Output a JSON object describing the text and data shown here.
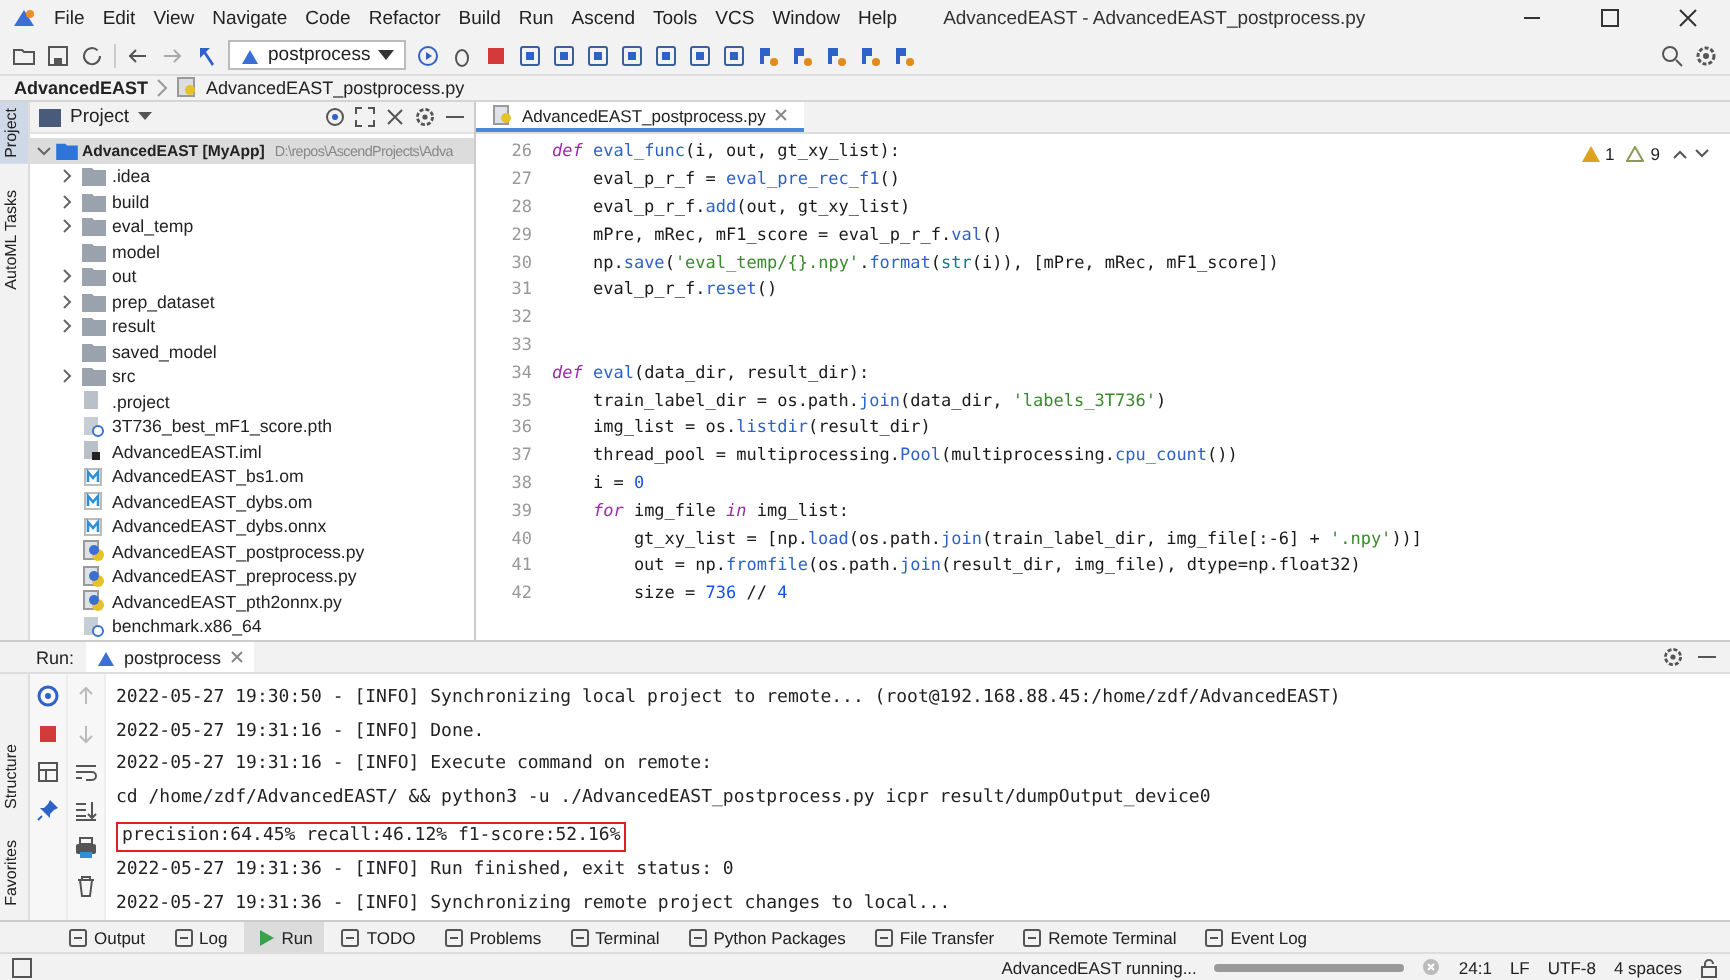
{
  "window": {
    "title": "AdvancedEAST - AdvancedEAST_postprocess.py"
  },
  "menu": [
    "File",
    "Edit",
    "View",
    "Navigate",
    "Code",
    "Refactor",
    "Build",
    "Run",
    "Ascend",
    "Tools",
    "VCS",
    "Window",
    "Help"
  ],
  "run_config": "postprocess",
  "breadcrumb": [
    "AdvancedEAST",
    "AdvancedEAST_postprocess.py"
  ],
  "left_stripe": [
    {
      "label": "Project",
      "selected": true
    },
    {
      "label": "AutoML Tasks",
      "selected": false
    }
  ],
  "project_panel": {
    "title": "Project",
    "root": {
      "name": "AdvancedEAST",
      "module": "[MyApp]",
      "path": "D:\\repos\\AscendProjects\\Adva",
      "expanded": true,
      "selected": true,
      "children": [
        {
          "name": ".idea",
          "kind": "folder",
          "expanded": false,
          "selected": false
        },
        {
          "name": "build",
          "kind": "folder",
          "expanded": false,
          "selected": false
        },
        {
          "name": "eval_temp",
          "kind": "folder",
          "expanded": false,
          "selected": false
        },
        {
          "name": "model",
          "kind": "folder-empty",
          "selected": false
        },
        {
          "name": "out",
          "kind": "folder",
          "expanded": false,
          "selected": false
        },
        {
          "name": "prep_dataset",
          "kind": "folder",
          "expanded": false,
          "selected": false
        },
        {
          "name": "result",
          "kind": "folder",
          "expanded": false,
          "selected": false
        },
        {
          "name": "saved_model",
          "kind": "folder-empty",
          "selected": false
        },
        {
          "name": "src",
          "kind": "folder",
          "expanded": false,
          "selected": false
        },
        {
          "name": ".project",
          "kind": "file",
          "selected": false
        },
        {
          "name": "3T736_best_mF1_score.pth",
          "kind": "unknown",
          "selected": false
        },
        {
          "name": "AdvancedEAST.iml",
          "kind": "iml",
          "selected": false
        },
        {
          "name": "AdvancedEAST_bs1.om",
          "kind": "model",
          "selected": false
        },
        {
          "name": "AdvancedEAST_dybs.om",
          "kind": "model",
          "selected": false
        },
        {
          "name": "AdvancedEAST_dybs.onnx",
          "kind": "model",
          "selected": false
        },
        {
          "name": "AdvancedEAST_postprocess.py",
          "kind": "python",
          "selected": false
        },
        {
          "name": "AdvancedEAST_preprocess.py",
          "kind": "python",
          "selected": false
        },
        {
          "name": "AdvancedEAST_pth2onnx.py",
          "kind": "python",
          "selected": false
        },
        {
          "name": "benchmark.x86_64",
          "kind": "unknown",
          "selected": false
        }
      ]
    }
  },
  "editor": {
    "tab": "AdvancedEAST_postprocess.py",
    "warnings": "1",
    "weak_warnings": "9",
    "lines": [
      {
        "number": "26",
        "tokens": [
          {
            "kind": "kw",
            "t": "def"
          },
          {
            "kind": "fn",
            "t": " eval_func"
          },
          {
            "kind": "p",
            "t": "(i, out, gt_xy_list):"
          }
        ]
      },
      {
        "number": "27",
        "tokens": [
          {
            "kind": "p",
            "t": "    eval_p_r_f = "
          },
          {
            "kind": "fn",
            "t": "eval_pre_rec_f1"
          },
          {
            "kind": "p",
            "t": "()"
          }
        ]
      },
      {
        "number": "28",
        "tokens": [
          {
            "kind": "p",
            "t": "    eval_p_r_f."
          },
          {
            "kind": "fn",
            "t": "add"
          },
          {
            "kind": "p",
            "t": "(out, gt_xy_list)"
          }
        ]
      },
      {
        "number": "29",
        "tokens": [
          {
            "kind": "p",
            "t": "    mPre, mRec, mF1_score = eval_p_r_f."
          },
          {
            "kind": "fn",
            "t": "val"
          },
          {
            "kind": "p",
            "t": "()"
          }
        ]
      },
      {
        "number": "30",
        "tokens": [
          {
            "kind": "p",
            "t": "    np."
          },
          {
            "kind": "fn",
            "t": "save"
          },
          {
            "kind": "p",
            "t": "("
          },
          {
            "kind": "str",
            "t": "'eval_temp/{}.npy'"
          },
          {
            "kind": "p",
            "t": "."
          },
          {
            "kind": "fn",
            "t": "format"
          },
          {
            "kind": "p",
            "t": "("
          },
          {
            "kind": "builtin",
            "t": "str"
          },
          {
            "kind": "p",
            "t": "(i)), [mPre, mRec, mF1_score])"
          }
        ]
      },
      {
        "number": "31",
        "tokens": [
          {
            "kind": "p",
            "t": "    eval_p_r_f."
          },
          {
            "kind": "fn",
            "t": "reset"
          },
          {
            "kind": "p",
            "t": "()"
          }
        ]
      },
      {
        "number": "32"
      },
      {
        "number": "33"
      },
      {
        "number": "34",
        "tokens": [
          {
            "kind": "kw",
            "t": "def"
          },
          {
            "kind": "fn",
            "t": " eval"
          },
          {
            "kind": "p",
            "t": "(data_dir, result_dir):"
          }
        ]
      },
      {
        "number": "35",
        "tokens": [
          {
            "kind": "p",
            "t": "    train_label_dir = os.path."
          },
          {
            "kind": "fn",
            "t": "join"
          },
          {
            "kind": "p",
            "t": "(data_dir, "
          },
          {
            "kind": "str",
            "t": "'labels_3T736'"
          },
          {
            "kind": "p",
            "t": ")"
          }
        ]
      },
      {
        "number": "36",
        "tokens": [
          {
            "kind": "p",
            "t": "    img_list = os."
          },
          {
            "kind": "fn",
            "t": "listdir"
          },
          {
            "kind": "p",
            "t": "(result_dir)"
          }
        ]
      },
      {
        "number": "37",
        "tokens": [
          {
            "kind": "p",
            "t": "    thread_pool = multiprocessing."
          },
          {
            "kind": "fn",
            "t": "Pool"
          },
          {
            "kind": "p",
            "t": "(multiprocessing."
          },
          {
            "kind": "fn",
            "t": "cpu_count"
          },
          {
            "kind": "p",
            "t": "())"
          }
        ]
      },
      {
        "number": "38",
        "tokens": [
          {
            "kind": "p",
            "t": "    i = "
          },
          {
            "kind": "num",
            "t": "0"
          }
        ]
      },
      {
        "number": "39",
        "tokens": [
          {
            "kind": "kw",
            "t": "    for"
          },
          {
            "kind": "p",
            "t": " img_file "
          },
          {
            "kind": "kw",
            "t": "in"
          },
          {
            "kind": "p",
            "t": " img_list:"
          }
        ]
      },
      {
        "number": "40",
        "tokens": [
          {
            "kind": "p",
            "t": "        gt_xy_list = [np."
          },
          {
            "kind": "fn",
            "t": "load"
          },
          {
            "kind": "p",
            "t": "(os.path."
          },
          {
            "kind": "fn",
            "t": "join"
          },
          {
            "kind": "p",
            "t": "(train_label_dir, img_file[:-6] + "
          },
          {
            "kind": "str",
            "t": "'.npy'"
          },
          {
            "kind": "p",
            "t": "))]"
          }
        ]
      },
      {
        "number": "41",
        "tokens": [
          {
            "kind": "p",
            "t": "        out = np."
          },
          {
            "kind": "fn",
            "t": "fromfile"
          },
          {
            "kind": "p",
            "t": "(os.path."
          },
          {
            "kind": "fn",
            "t": "join"
          },
          {
            "kind": "p",
            "t": "(result_dir, img_file), dtype=np.float32)"
          }
        ]
      },
      {
        "number": "42",
        "tokens": [
          {
            "kind": "p",
            "t": "        size = "
          },
          {
            "kind": "num",
            "t": "736"
          },
          {
            "kind": "p",
            "t": " // "
          },
          {
            "kind": "num",
            "t": "4"
          }
        ]
      }
    ]
  },
  "run_panel": {
    "label": "Run:",
    "tab": "postprocess",
    "lines": [
      {
        "text": "2022-05-27 19:30:50 - [INFO] Synchronizing local project to remote... (root@192.168.88.45:/home/zdf/AdvancedEAST)",
        "boxed": false
      },
      {
        "text": "2022-05-27 19:31:16 - [INFO] Done.",
        "boxed": false
      },
      {
        "text": "2022-05-27 19:31:16 - [INFO] Execute command on remote:",
        "boxed": false
      },
      {
        "text": "cd /home/zdf/AdvancedEAST/ && python3 -u ./AdvancedEAST_postprocess.py icpr result/dumpOutput_device0",
        "boxed": false
      },
      {
        "text": "precision:64.45% recall:46.12% f1-score:52.16%",
        "boxed": true
      },
      {
        "text": "2022-05-27 19:31:36 - [INFO] Run finished, exit status: 0",
        "boxed": false
      },
      {
        "text": "2022-05-27 19:31:36 - [INFO] Synchronizing remote project changes to local...",
        "boxed": false
      }
    ]
  },
  "side_tabs": [
    "Structure",
    "Favorites"
  ],
  "tool_tabs": [
    {
      "label": "Output",
      "selected": false
    },
    {
      "label": "Log",
      "selected": false
    },
    {
      "label": "Run",
      "selected": true
    },
    {
      "label": "TODO",
      "selected": false
    },
    {
      "label": "Problems",
      "selected": false
    },
    {
      "label": "Terminal",
      "selected": false
    },
    {
      "label": "Python Packages",
      "selected": false
    },
    {
      "label": "File Transfer",
      "selected": false
    },
    {
      "label": "Remote Terminal",
      "selected": false
    },
    {
      "label": "Event Log",
      "selected": false
    }
  ],
  "status_bar": {
    "task": "AdvancedEAST running...",
    "level": 1,
    "position": "24:1",
    "line_separator": "LF",
    "encoding": "UTF-8",
    "indent": "4 spaces"
  }
}
